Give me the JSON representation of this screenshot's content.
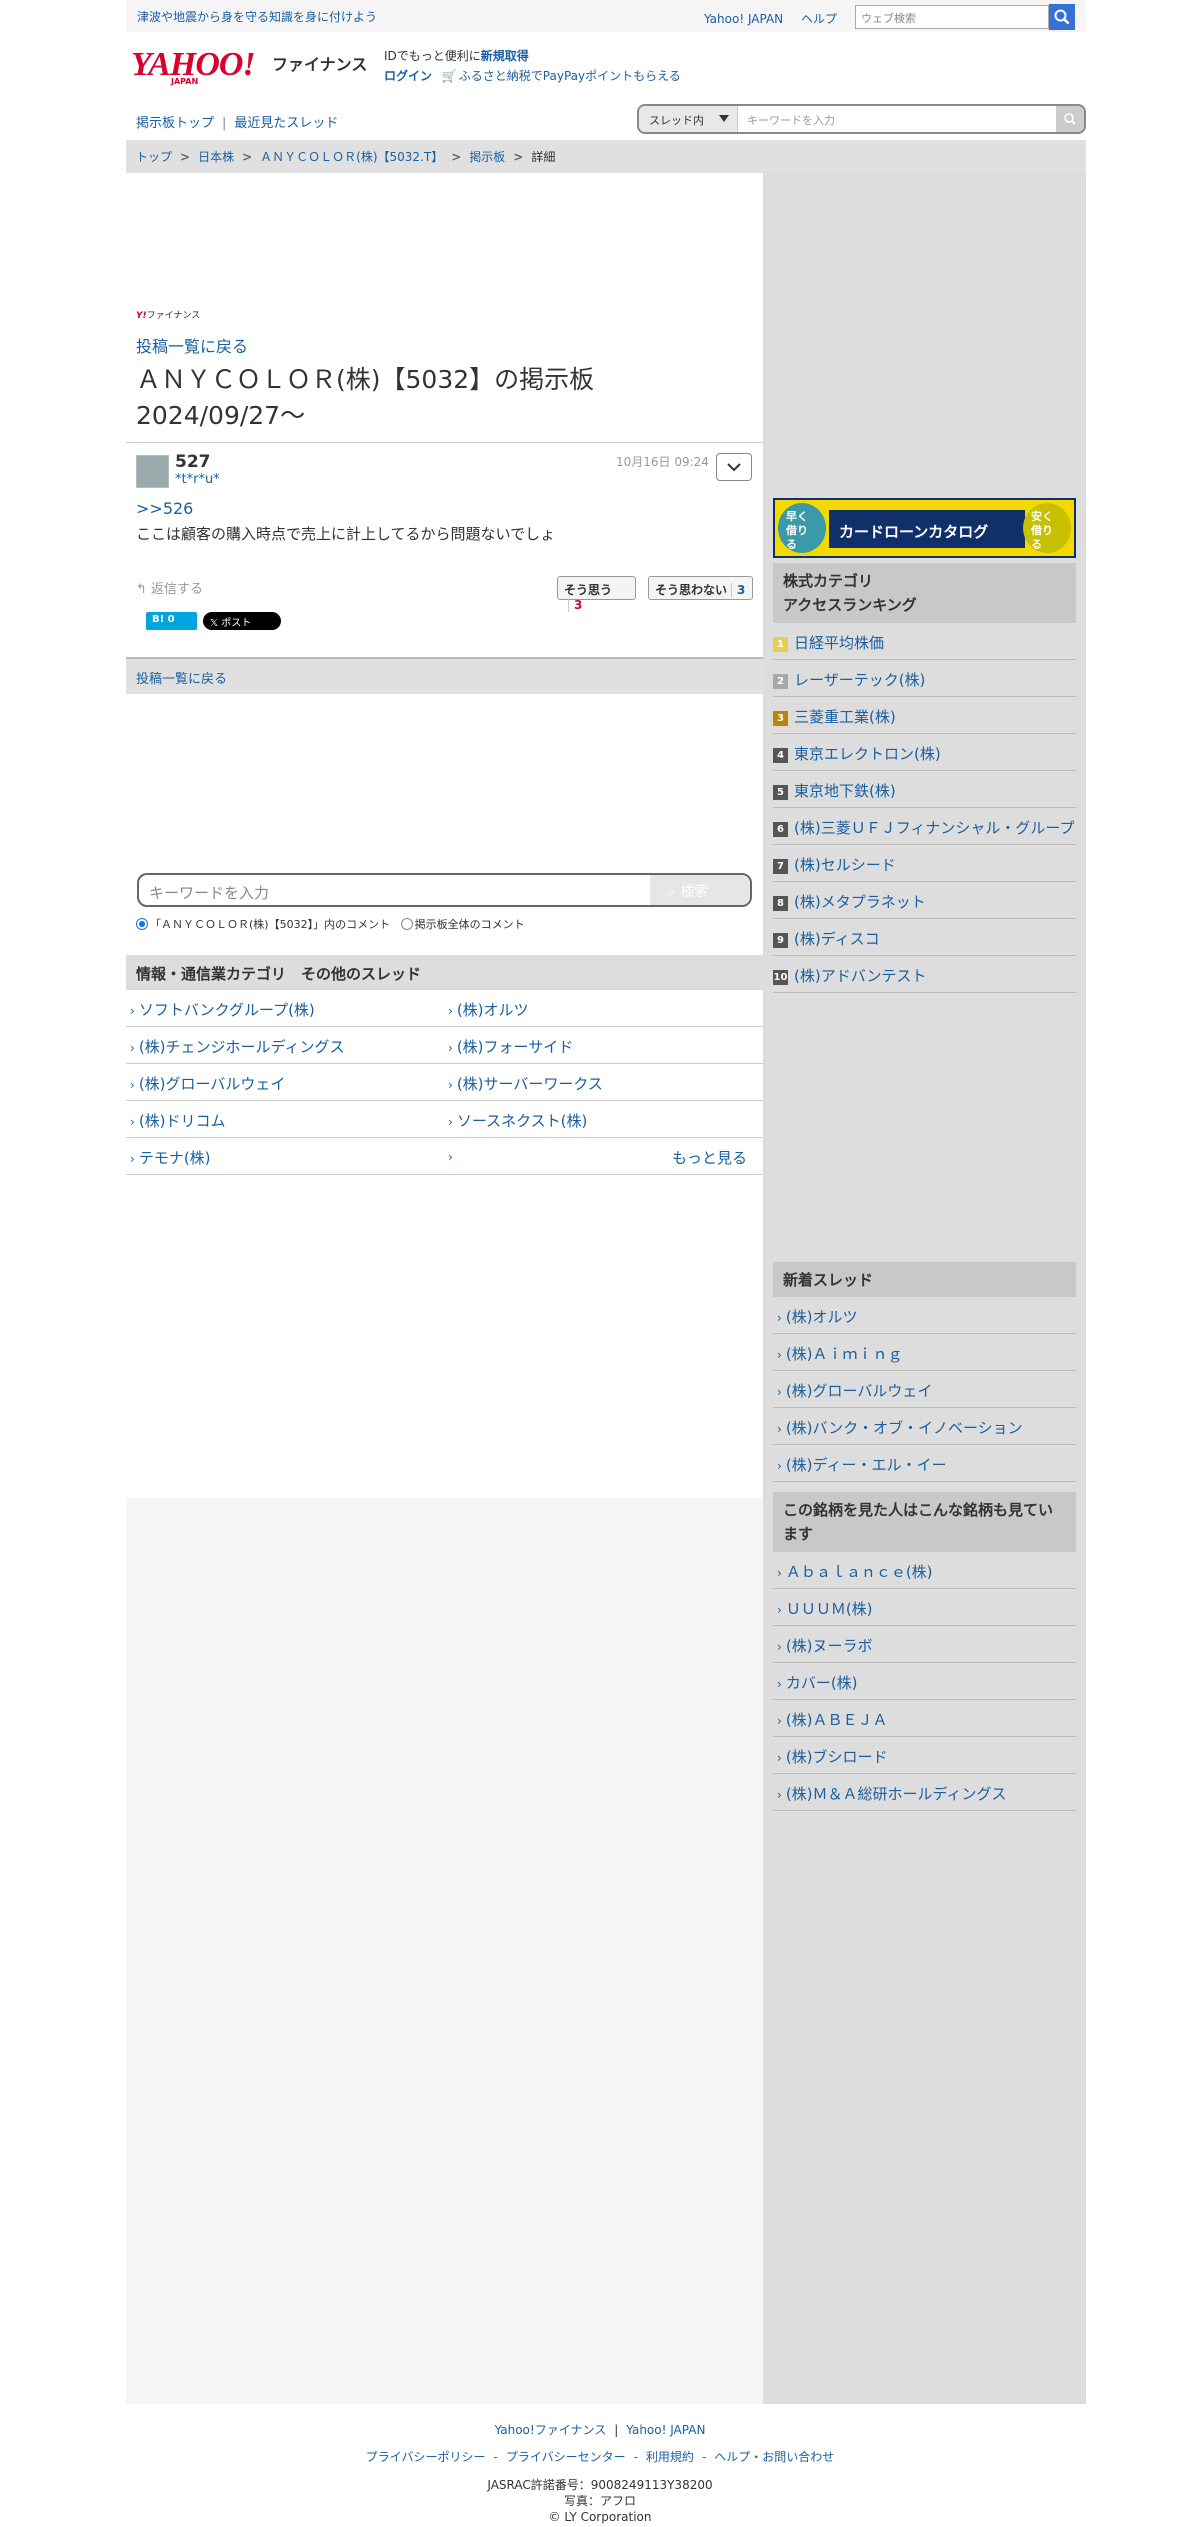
{
  "topbar": {
    "promo": "津波や地震から身を守る知識を身に付けよう",
    "links": [
      "Yahoo! JAPAN",
      "ヘルプ"
    ],
    "web_search_placeholder": "ウェブ検索"
  },
  "header": {
    "logo_main": "YAHOO!",
    "logo_sub": "JAPAN",
    "service": "ファイナンス",
    "login_line1_pre": "IDでもっと便利に",
    "login_line1_link": "新規取得",
    "login_link": "ログイン",
    "furusato": "ふるさと納税でPayPayポイントもらえる"
  },
  "subnav": {
    "board_top": "掲示板トップ",
    "sep": "|",
    "recent": "最近見たスレッド"
  },
  "thread_search": {
    "scope": "スレッド内",
    "placeholder": "キーワードを入力"
  },
  "breadcrumb": [
    "トップ",
    "日本株",
    "ＡＮＹＣＯＬＯＲ(株)【5032.T】",
    "掲示板",
    "詳細"
  ],
  "ad_mark": "ファイナンス",
  "ad_mark_y": "Y!",
  "back_to_list": "投稿一覧に戻る",
  "board_title": "ＡＮＹＣＯＬＯＲ(株)【5032】の掲示板 2024/09/27〜",
  "post": {
    "number": "527",
    "user": "*t*r*u*",
    "date": "10月16日 09:24",
    "reply_ref": ">>526",
    "body": "ここは顧客の購入時点で売上に計上してるから問題ないでしょ",
    "reply": "返信する",
    "agree_label": "そう思う",
    "agree_count": "3",
    "disagree_label": "そう思わない",
    "disagree_count": "3",
    "hatena": "B! 0",
    "x_post": "𝕏 ポスト"
  },
  "keyword_search": {
    "placeholder": "キーワードを入力",
    "button": "検索",
    "scope_thread": "「ＡＮＹＣＯＬＯＲ(株)【5032】」内のコメント",
    "scope_all": "掲示板全体のコメント"
  },
  "others": {
    "heading": "情報・通信業カテゴリ　その他のスレッド",
    "items": [
      "ソフトバンクグループ(株)",
      "(株)オルツ",
      "(株)チェンジホールディングス",
      "(株)フォーサイド",
      "(株)グローバルウェイ",
      "(株)サーバーワークス",
      "(株)ドリコム",
      "ソースネクスト(株)",
      "テモナ(株)"
    ],
    "more": "もっと見る"
  },
  "banner": {
    "left": "早く借りる",
    "center": "カードローンカタログ",
    "right": "安く借りる"
  },
  "ranking": {
    "heading_1": "株式カテゴリ",
    "heading_2": "アクセスランキング",
    "items": [
      {
        "n": "1",
        "name": "日経平均株価"
      },
      {
        "n": "2",
        "name": "レーザーテック(株)"
      },
      {
        "n": "3",
        "name": "三菱重工業(株)"
      },
      {
        "n": "4",
        "name": "東京エレクトロン(株)"
      },
      {
        "n": "5",
        "name": "東京地下鉄(株)"
      },
      {
        "n": "6",
        "name": "(株)三菱ＵＦＪフィナンシャル・グループ"
      },
      {
        "n": "7",
        "name": "(株)セルシード"
      },
      {
        "n": "8",
        "name": "(株)メタプラネット"
      },
      {
        "n": "9",
        "name": "(株)ディスコ"
      },
      {
        "n": "10",
        "name": "(株)アドバンテスト"
      }
    ]
  },
  "new_threads": {
    "heading": "新着スレッド",
    "items": [
      "(株)オルツ",
      "(株)Ａｉｍｉｎｇ",
      "(株)グローバルウェイ",
      "(株)バンク・オブ・イノベーション",
      "(株)ディー・エル・イー"
    ]
  },
  "also_viewed": {
    "heading": "この銘柄を見た人はこんな銘柄も見ています",
    "items": [
      "Ａｂａｌａｎｃｅ(株)",
      "ＵＵＵＭ(株)",
      "(株)ヌーラボ",
      "カバー(株)",
      "(株)ＡＢＥＪＡ",
      "(株)ブシロード",
      "(株)Ｍ＆Ａ総研ホールディングス"
    ]
  },
  "footer": {
    "row1": [
      "Yahoo!ファイナンス",
      "Yahoo! JAPAN"
    ],
    "row2": [
      "プライバシーポリシー",
      "プライバシーセンター",
      "利用規約",
      "ヘルプ・お問い合わせ"
    ],
    "jasrac": "JASRAC許諾番号：9008249113Y38200",
    "photo": "写真：アフロ",
    "copyright": "© LY Corporation"
  },
  "colors": {
    "link": "#1a5fa0",
    "brand_red": "#d7022e",
    "sidebar_bg": "#dddddd"
  }
}
